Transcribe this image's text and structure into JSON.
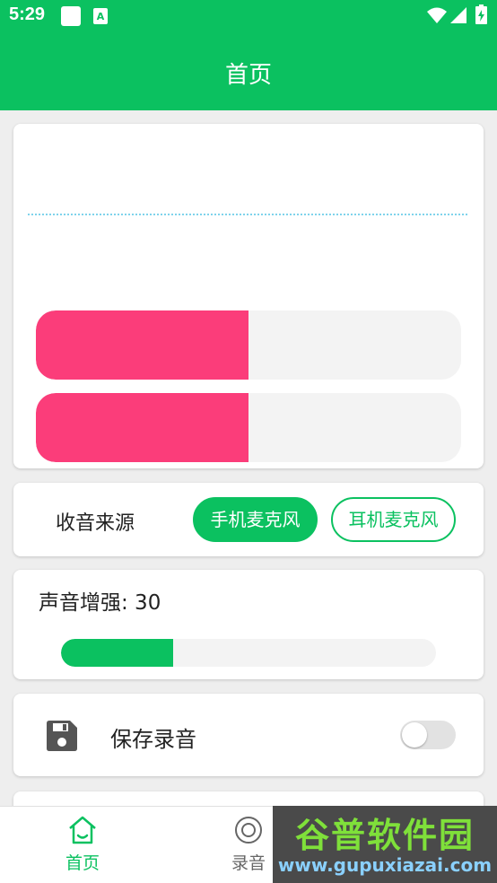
{
  "status_bar": {
    "time": "5:29"
  },
  "toolbar": {
    "title": "首页"
  },
  "level_meters": [
    {
      "level": 0.5
    },
    {
      "level": 0.5
    }
  ],
  "source": {
    "label": "收音来源",
    "options": [
      "手机麦克风",
      "耳机麦克风"
    ],
    "selected": "手机麦克风"
  },
  "boost": {
    "label": "声音增强: 30",
    "value": 30,
    "max": 100
  },
  "save": {
    "label": "保存录音",
    "enabled": false
  },
  "bottom_nav": {
    "home_label": "首页",
    "record_label": "录音"
  },
  "watermark": {
    "title": "谷普软件园",
    "url": "www.gupuxiazai.com"
  },
  "colors": {
    "primary": "#0bc160",
    "meter": "#fb3d7a",
    "wave": "#7fd3ec"
  }
}
